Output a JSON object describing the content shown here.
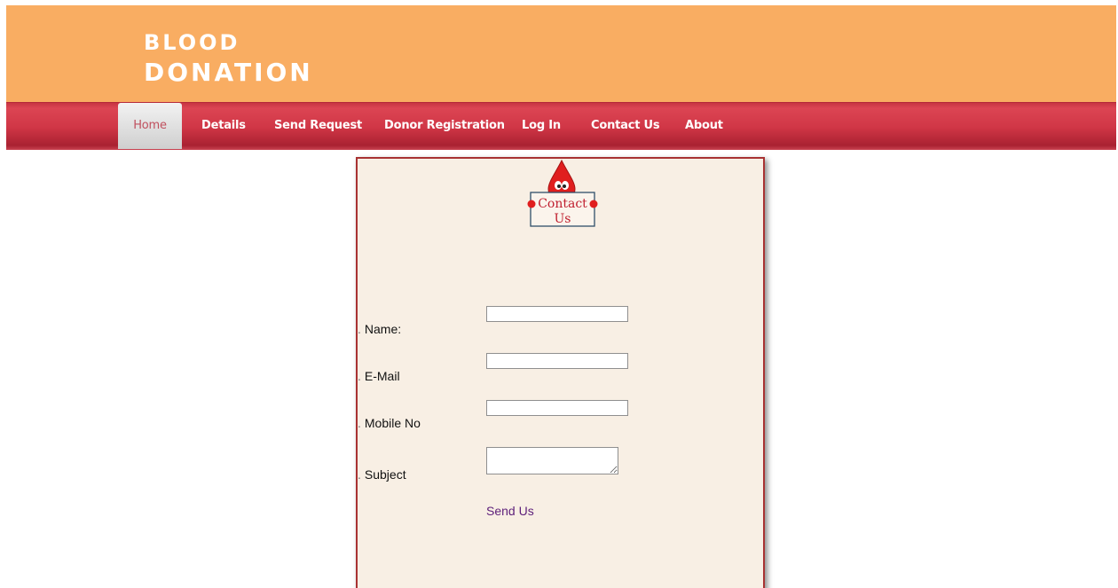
{
  "header": {
    "brand_line1": "BLOOD",
    "brand_line2": "DONATION",
    "background": "#f9ad62"
  },
  "nav": {
    "items": [
      {
        "label": "Home",
        "active": true
      },
      {
        "label": "Details"
      },
      {
        "label": "Send Request"
      },
      {
        "label": "Donor Registration"
      },
      {
        "label": "Log In"
      },
      {
        "label": "Contact Us"
      },
      {
        "label": "About"
      }
    ],
    "accent": "#d03646"
  },
  "contact": {
    "logo_line1": "Contact",
    "logo_line2": "Us",
    "fields": [
      {
        "label": "Name:",
        "value": ""
      },
      {
        "label": "E-Mail",
        "value": ""
      },
      {
        "label": "Mobile No",
        "value": ""
      },
      {
        "label": "Subject",
        "value": ""
      }
    ],
    "submit_label": "Send Us"
  }
}
